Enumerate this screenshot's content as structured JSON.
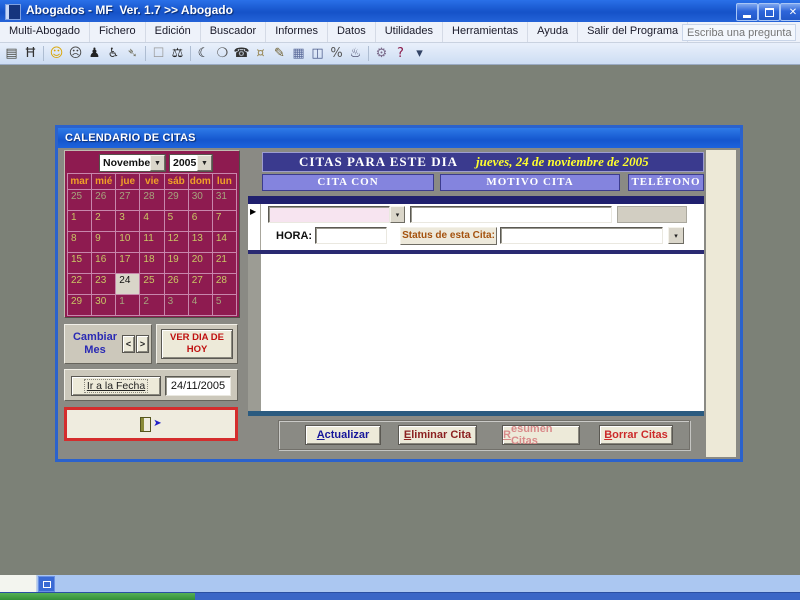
{
  "ui": {
    "dropdown_glyph": "▼",
    "small_dropdown_glyph": "▾",
    "record_marker_glyph": "▶",
    "exit_arrow_glyph": "➤",
    "close_glyph": "✕"
  },
  "window": {
    "title": "Abogados - MF  Ver. 1.7 >> Abogado"
  },
  "menu": {
    "items": [
      "Multi-Abogado",
      "Fichero",
      "Edición",
      "Buscador",
      "Informes",
      "Datos",
      "Utilidades",
      "Herramientas",
      "Ayuda",
      "Salir del Programa"
    ],
    "question_placeholder": "Escriba una pregunta"
  },
  "toolbar": {
    "icons": [
      {
        "name": "copy-stack-icon",
        "glyph": "▤",
        "color": "#4A4A42"
      },
      {
        "name": "letter-h-icon",
        "glyph": "Ħ",
        "color": "#333333"
      },
      {
        "sep": true
      },
      {
        "name": "happy-face-icon",
        "glyph": "☺",
        "color": "#D9A400"
      },
      {
        "name": "sad-face-icon",
        "glyph": "☹",
        "color": "#444444"
      },
      {
        "name": "person-icon",
        "glyph": "♟",
        "color": "#222222"
      },
      {
        "name": "accessibility-icon",
        "glyph": "♿",
        "color": "#333333"
      },
      {
        "name": "key-icon",
        "glyph": "➴",
        "color": "#7A7A6A"
      },
      {
        "sep": true
      },
      {
        "name": "blank-checkbox-icon",
        "glyph": "☐",
        "color": "#999999"
      },
      {
        "name": "scales-icon",
        "glyph": "⚖",
        "color": "#222222"
      },
      {
        "sep": true
      },
      {
        "name": "phone-handset-icon",
        "glyph": "☾",
        "color": "#111111"
      },
      {
        "name": "speech-bubble-icon",
        "glyph": "❍",
        "color": "#555555"
      },
      {
        "name": "telephone-icon",
        "glyph": "☎",
        "color": "#333333"
      },
      {
        "name": "piggy-bank-icon",
        "glyph": "¤",
        "color": "#9A8A5A"
      },
      {
        "name": "pencil-icon",
        "glyph": "✎",
        "color": "#6A5A2A"
      },
      {
        "name": "calculator-icon",
        "glyph": "▦",
        "color": "#5A6A9A"
      },
      {
        "name": "ledger-icon",
        "glyph": "◫",
        "color": "#4A5A8A"
      },
      {
        "name": "percent-icon",
        "glyph": "%",
        "color": "#555555"
      },
      {
        "name": "ink-bottle-icon",
        "glyph": "♨",
        "color": "#3A3A5A"
      },
      {
        "sep": true
      },
      {
        "name": "gears-icon",
        "glyph": "⚙",
        "color": "#7A6A8A"
      },
      {
        "name": "help-icon",
        "glyph": "?",
        "color": "#8B1A4A"
      },
      {
        "name": "toolbar-overflow-icon",
        "glyph": "▾",
        "color": "#334466"
      }
    ]
  },
  "dialog": {
    "title": "CALENDARIO DE CITAS",
    "calendar": {
      "month": "November",
      "year": "2005",
      "weekdays": [
        "mar",
        "mié",
        "jue",
        "vie",
        "sáb",
        "dom",
        "lun"
      ],
      "weeks": [
        [
          {
            "d": "25",
            "m": "other"
          },
          {
            "d": "26",
            "m": "other"
          },
          {
            "d": "27",
            "m": "other"
          },
          {
            "d": "28",
            "m": "other"
          },
          {
            "d": "29",
            "m": "other"
          },
          {
            "d": "30",
            "m": "other"
          },
          {
            "d": "31",
            "m": "other"
          }
        ],
        [
          {
            "d": "1"
          },
          {
            "d": "2"
          },
          {
            "d": "3"
          },
          {
            "d": "4"
          },
          {
            "d": "5"
          },
          {
            "d": "6"
          },
          {
            "d": "7"
          }
        ],
        [
          {
            "d": "8"
          },
          {
            "d": "9"
          },
          {
            "d": "10"
          },
          {
            "d": "11"
          },
          {
            "d": "12"
          },
          {
            "d": "13"
          },
          {
            "d": "14"
          }
        ],
        [
          {
            "d": "15"
          },
          {
            "d": "16"
          },
          {
            "d": "17"
          },
          {
            "d": "18"
          },
          {
            "d": "19"
          },
          {
            "d": "20"
          },
          {
            "d": "21"
          }
        ],
        [
          {
            "d": "22"
          },
          {
            "d": "23"
          },
          {
            "d": "24",
            "selected": true
          },
          {
            "d": "25"
          },
          {
            "d": "26"
          },
          {
            "d": "27"
          },
          {
            "d": "28"
          }
        ],
        [
          {
            "d": "29"
          },
          {
            "d": "30"
          },
          {
            "d": "1",
            "m": "other"
          },
          {
            "d": "2",
            "m": "other"
          },
          {
            "d": "3",
            "m": "other"
          },
          {
            "d": "4",
            "m": "other"
          },
          {
            "d": "5",
            "m": "other"
          }
        ]
      ]
    },
    "nav": {
      "change_month": "Cambiar Mes",
      "prev": "<",
      "next": ">",
      "today": "VER DIA DE HOY",
      "goto": "Ir a la Fecha",
      "date_value": "24/11/2005"
    },
    "appointments": {
      "header": "CITAS PARA ESTE DIA",
      "header_date": "jueves, 24 de noviembre de 2005",
      "columns": [
        "CITA CON",
        "MOTIVO CITA",
        "TELÉFONO"
      ],
      "hora_label": "HORA:",
      "status_label": "Status de esta Cita:",
      "buttons": [
        {
          "name": "actualizar-button",
          "label": "Actualizar",
          "color": "#16169A",
          "disabled": false
        },
        {
          "name": "eliminar-cita-button",
          "label": "Eliminar Cita",
          "color": "#8B2020",
          "disabled": false
        },
        {
          "name": "resumen-citas-button",
          "label": "Resumen Citas",
          "color": "#D98A8A",
          "disabled": true
        },
        {
          "name": "borrar-citas-button",
          "label": "Borrar Citas",
          "color": "#CC2A2A",
          "disabled": false
        }
      ]
    }
  }
}
